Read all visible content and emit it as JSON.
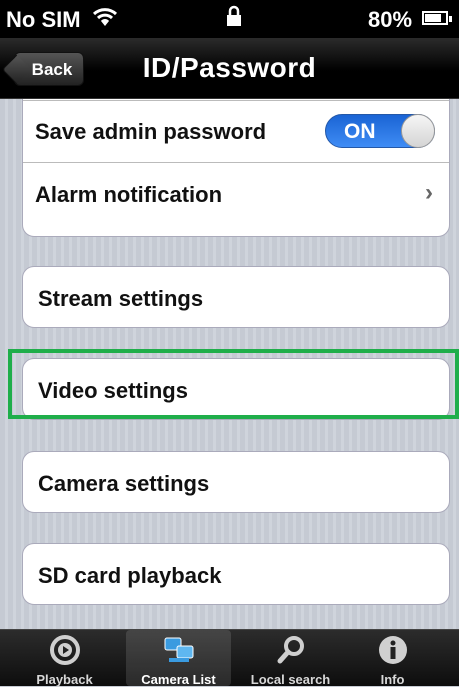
{
  "status": {
    "carrier": "No SIM",
    "battery": "80%",
    "battery_level": 0.8
  },
  "nav": {
    "back_label": "Back",
    "title": "ID/Password"
  },
  "settings": {
    "save_admin_label": "Save admin password",
    "save_admin_toggle": "ON",
    "alarm_label": "Alarm notification",
    "alarm_chevron": "›",
    "items": [
      {
        "label": "Stream settings"
      },
      {
        "label": "Video settings"
      },
      {
        "label": "Camera settings"
      },
      {
        "label": "SD card playback"
      }
    ]
  },
  "tabs": [
    {
      "label": "Playback",
      "icon": "playback-icon"
    },
    {
      "label": "Camera List",
      "icon": "camera-list-icon",
      "active": true
    },
    {
      "label": "Local search",
      "icon": "search-icon"
    },
    {
      "label": "Info",
      "icon": "info-icon"
    }
  ],
  "colors": {
    "accent": "#2a6fe0",
    "highlight": "#1fae4a"
  }
}
